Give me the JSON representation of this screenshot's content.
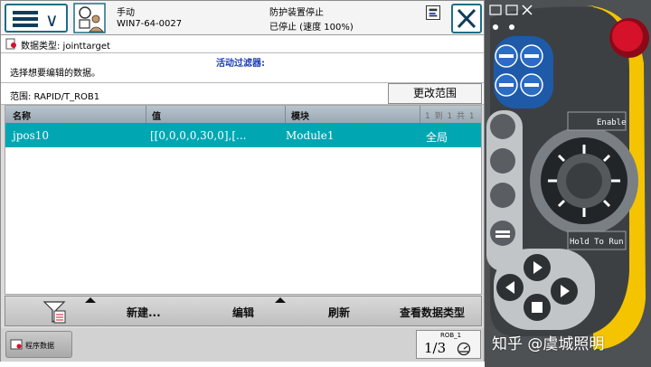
{
  "topbar": {
    "mode": "手动",
    "host": "WIN7-64-0027",
    "guard_stop": "防护装置停止",
    "stopped_state": "已停止 (速度 100%)"
  },
  "datatype": {
    "label": "数据类型: jointtarget"
  },
  "instruction": {
    "filter_label": "活动过滤器:",
    "text": "选择想要编辑的数据。"
  },
  "scope": {
    "text": "范围: RAPID/T_ROB1",
    "change_button": "更改范围"
  },
  "table": {
    "columns": [
      "名称",
      "值",
      "模块"
    ],
    "pager": "1 到 1 共 1",
    "rows": [
      {
        "name": "jpos10",
        "value": "[[0,0,0,0,30,0],[...",
        "module": "Module1",
        "scope": "全局"
      }
    ]
  },
  "bottombar": {
    "new": "新建...",
    "edit": "编辑",
    "refresh": "刷新",
    "view_type": "查看数据类型"
  },
  "taskbar": {
    "program_data": "程序数据",
    "robot": "ROB_1",
    "fraction": "1/3"
  },
  "pendant": {
    "enable": "Enable",
    "hold_to_run": "Hold To Run"
  },
  "watermark": "知乎 @虞城照明",
  "colors": {
    "selection": "#00a7b3",
    "frame": "#1d6f86",
    "pendant_body": "#55595c",
    "pendant_keys": "#1e5aa8",
    "stop_button": "#d6112a",
    "pendant_yellow": "#f4c400"
  }
}
